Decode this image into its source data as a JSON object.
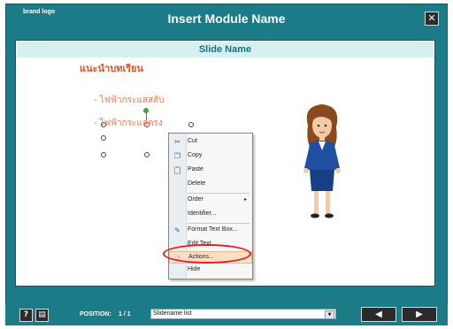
{
  "window": {
    "brand_logo": "brand logo",
    "module_title": "Insert Module Name",
    "close_glyph": "✕"
  },
  "slide": {
    "name": "Slide Name",
    "thai_title": "แนะนำบทเรียน",
    "bullet_1": "- ไฟฟ้ากระแสสลับ",
    "bullet_2": "- ไฟฟ้ากระแสตรง"
  },
  "context_menu": {
    "items": [
      {
        "label": "Cut",
        "icon": "scissors-icon"
      },
      {
        "label": "Copy",
        "icon": "copy-icon"
      },
      {
        "label": "Paste",
        "icon": "paste-icon"
      },
      {
        "label": "Delete",
        "icon": ""
      },
      {
        "label": "Order",
        "icon": "",
        "submenu": "▸"
      },
      {
        "label": "Identifier...",
        "icon": ""
      },
      {
        "label": "Format Text Box...",
        "icon": "format-icon"
      },
      {
        "label": "Edit Text...",
        "icon": ""
      },
      {
        "label": "Actions...",
        "icon": "actions-icon"
      },
      {
        "label": "Hide",
        "icon": ""
      }
    ],
    "highlighted": "Actions..."
  },
  "footer": {
    "help_glyph": "?",
    "notes_glyph": "▤",
    "position_label": "POSITION:",
    "position_value": "1 / 1",
    "slide_select_value": "Slidename list",
    "select_arrow": "▼",
    "prev_glyph": "◀",
    "next_glyph": "▶"
  },
  "colors": {
    "frame": "#1b7b86",
    "highlight_ring": "#e11f1f",
    "slide_name_bar": "#d6efef",
    "thai_text": "#e0512a"
  }
}
